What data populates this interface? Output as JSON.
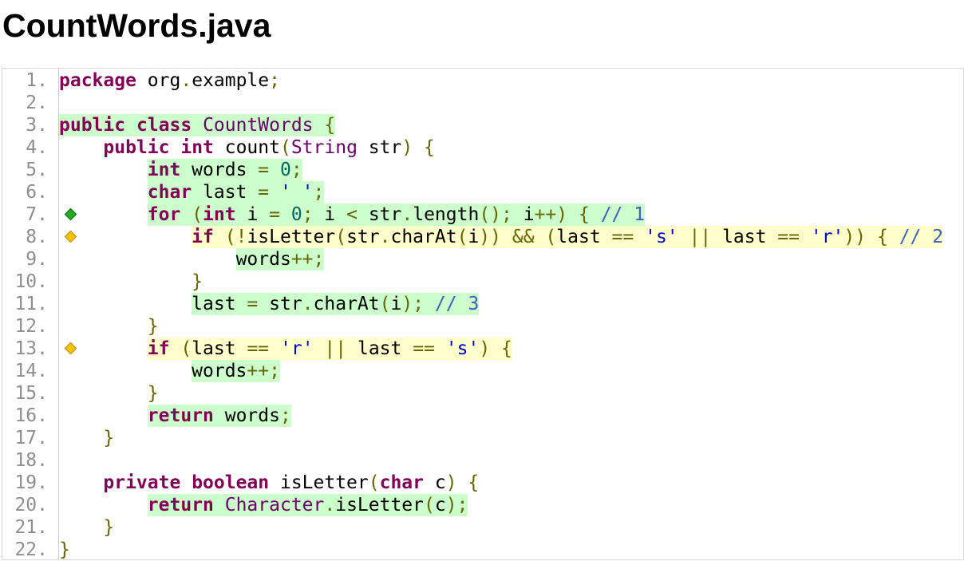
{
  "file": {
    "title": "CountWords.java"
  },
  "lines": [
    {
      "n": "1.",
      "cov": "none",
      "branch": "",
      "indent": "",
      "tokens": [
        {
          "t": "package",
          "c": "kw"
        },
        {
          "t": " org"
        },
        {
          "t": ".",
          "c": "pn"
        },
        {
          "t": "example"
        },
        {
          "t": ";",
          "c": "pn"
        }
      ]
    },
    {
      "n": "2.",
      "cov": "none",
      "branch": "",
      "indent": "",
      "tokens": []
    },
    {
      "n": "3.",
      "cov": "full",
      "branch": "",
      "indent": "",
      "tokens": [
        {
          "t": "public",
          "c": "kw"
        },
        {
          "t": " "
        },
        {
          "t": "class",
          "c": "kw"
        },
        {
          "t": " "
        },
        {
          "t": "CountWords",
          "c": "ty"
        },
        {
          "t": " "
        },
        {
          "t": "{",
          "c": "pn"
        }
      ]
    },
    {
      "n": "4.",
      "cov": "none",
      "branch": "",
      "indent": "    ",
      "tokens": [
        {
          "t": "public",
          "c": "kw"
        },
        {
          "t": " "
        },
        {
          "t": "int",
          "c": "kw"
        },
        {
          "t": " count"
        },
        {
          "t": "(",
          "c": "pn"
        },
        {
          "t": "String",
          "c": "ty"
        },
        {
          "t": " str"
        },
        {
          "t": ")",
          "c": "pn"
        },
        {
          "t": " "
        },
        {
          "t": "{",
          "c": "pn"
        }
      ]
    },
    {
      "n": "5.",
      "cov": "full",
      "branch": "",
      "indent": "        ",
      "tokens": [
        {
          "t": "int",
          "c": "kw"
        },
        {
          "t": " words "
        },
        {
          "t": "=",
          "c": "pn"
        },
        {
          "t": " "
        },
        {
          "t": "0",
          "c": "nm"
        },
        {
          "t": ";",
          "c": "pn"
        }
      ]
    },
    {
      "n": "6.",
      "cov": "full",
      "branch": "",
      "indent": "        ",
      "tokens": [
        {
          "t": "char",
          "c": "kw"
        },
        {
          "t": " last "
        },
        {
          "t": "=",
          "c": "pn"
        },
        {
          "t": " "
        },
        {
          "t": "' '",
          "c": "st"
        },
        {
          "t": ";",
          "c": "pn"
        }
      ]
    },
    {
      "n": "7.",
      "cov": "full",
      "branch": "green",
      "indent": "        ",
      "tokens": [
        {
          "t": "for",
          "c": "kw"
        },
        {
          "t": " "
        },
        {
          "t": "(",
          "c": "pn"
        },
        {
          "t": "int",
          "c": "kw"
        },
        {
          "t": " i "
        },
        {
          "t": "=",
          "c": "pn"
        },
        {
          "t": " "
        },
        {
          "t": "0",
          "c": "nm"
        },
        {
          "t": ";",
          "c": "pn"
        },
        {
          "t": " i "
        },
        {
          "t": "<",
          "c": "pn"
        },
        {
          "t": " str"
        },
        {
          "t": ".",
          "c": "pn"
        },
        {
          "t": "length"
        },
        {
          "t": "();",
          "c": "pn"
        },
        {
          "t": " i"
        },
        {
          "t": "++)",
          "c": "pn"
        },
        {
          "t": " "
        },
        {
          "t": "{",
          "c": "pn"
        },
        {
          "t": " "
        },
        {
          "t": "// 1",
          "c": "cm"
        }
      ]
    },
    {
      "n": "8.",
      "cov": "part",
      "branch": "yellow",
      "indent": "            ",
      "tokens": [
        {
          "t": "if",
          "c": "kw"
        },
        {
          "t": " "
        },
        {
          "t": "(!",
          "c": "pn"
        },
        {
          "t": "isLetter"
        },
        {
          "t": "(",
          "c": "pn"
        },
        {
          "t": "str"
        },
        {
          "t": ".",
          "c": "pn"
        },
        {
          "t": "charAt"
        },
        {
          "t": "(",
          "c": "pn"
        },
        {
          "t": "i"
        },
        {
          "t": "))",
          "c": "pn"
        },
        {
          "t": " "
        },
        {
          "t": "&&",
          "c": "pn"
        },
        {
          "t": " "
        },
        {
          "t": "(",
          "c": "pn"
        },
        {
          "t": "last "
        },
        {
          "t": "==",
          "c": "pn"
        },
        {
          "t": " "
        },
        {
          "t": "'s'",
          "c": "st"
        },
        {
          "t": " "
        },
        {
          "t": "||",
          "c": "pn"
        },
        {
          "t": " last "
        },
        {
          "t": "==",
          "c": "pn"
        },
        {
          "t": " "
        },
        {
          "t": "'r'",
          "c": "st"
        },
        {
          "t": "))",
          "c": "pn"
        },
        {
          "t": " "
        },
        {
          "t": "{",
          "c": "pn"
        },
        {
          "t": " "
        },
        {
          "t": "// 2",
          "c": "cm"
        }
      ]
    },
    {
      "n": "9.",
      "cov": "full",
      "branch": "",
      "indent": "                ",
      "tokens": [
        {
          "t": "words"
        },
        {
          "t": "++;",
          "c": "pn"
        }
      ]
    },
    {
      "n": "10.",
      "cov": "none",
      "branch": "",
      "indent": "            ",
      "tokens": [
        {
          "t": "}",
          "c": "pn"
        }
      ]
    },
    {
      "n": "11.",
      "cov": "full",
      "branch": "",
      "indent": "            ",
      "tokens": [
        {
          "t": "last "
        },
        {
          "t": "=",
          "c": "pn"
        },
        {
          "t": " str"
        },
        {
          "t": ".",
          "c": "pn"
        },
        {
          "t": "charAt"
        },
        {
          "t": "(",
          "c": "pn"
        },
        {
          "t": "i"
        },
        {
          "t": ");",
          "c": "pn"
        },
        {
          "t": " "
        },
        {
          "t": "// 3",
          "c": "cm"
        }
      ]
    },
    {
      "n": "12.",
      "cov": "none",
      "branch": "",
      "indent": "        ",
      "tokens": [
        {
          "t": "}",
          "c": "pn"
        }
      ]
    },
    {
      "n": "13.",
      "cov": "part",
      "branch": "yellow",
      "indent": "        ",
      "tokens": [
        {
          "t": "if",
          "c": "kw"
        },
        {
          "t": " "
        },
        {
          "t": "(",
          "c": "pn"
        },
        {
          "t": "last "
        },
        {
          "t": "==",
          "c": "pn"
        },
        {
          "t": " "
        },
        {
          "t": "'r'",
          "c": "st"
        },
        {
          "t": " "
        },
        {
          "t": "||",
          "c": "pn"
        },
        {
          "t": " last "
        },
        {
          "t": "==",
          "c": "pn"
        },
        {
          "t": " "
        },
        {
          "t": "'s'",
          "c": "st"
        },
        {
          "t": ")",
          "c": "pn"
        },
        {
          "t": " "
        },
        {
          "t": "{",
          "c": "pn"
        }
      ]
    },
    {
      "n": "14.",
      "cov": "full",
      "branch": "",
      "indent": "            ",
      "tokens": [
        {
          "t": "words"
        },
        {
          "t": "++;",
          "c": "pn"
        }
      ]
    },
    {
      "n": "15.",
      "cov": "none",
      "branch": "",
      "indent": "        ",
      "tokens": [
        {
          "t": "}",
          "c": "pn"
        }
      ]
    },
    {
      "n": "16.",
      "cov": "full",
      "branch": "",
      "indent": "        ",
      "tokens": [
        {
          "t": "return",
          "c": "kw"
        },
        {
          "t": " words"
        },
        {
          "t": ";",
          "c": "pn"
        }
      ]
    },
    {
      "n": "17.",
      "cov": "none",
      "branch": "",
      "indent": "    ",
      "tokens": [
        {
          "t": "}",
          "c": "pn"
        }
      ]
    },
    {
      "n": "18.",
      "cov": "none",
      "branch": "",
      "indent": "",
      "tokens": []
    },
    {
      "n": "19.",
      "cov": "none",
      "branch": "",
      "indent": "    ",
      "tokens": [
        {
          "t": "private",
          "c": "kw"
        },
        {
          "t": " "
        },
        {
          "t": "boolean",
          "c": "kw"
        },
        {
          "t": " isLetter"
        },
        {
          "t": "(",
          "c": "pn"
        },
        {
          "t": "char",
          "c": "kw"
        },
        {
          "t": " c"
        },
        {
          "t": ")",
          "c": "pn"
        },
        {
          "t": " "
        },
        {
          "t": "{",
          "c": "pn"
        }
      ]
    },
    {
      "n": "20.",
      "cov": "full",
      "branch": "",
      "indent": "        ",
      "tokens": [
        {
          "t": "return",
          "c": "kw"
        },
        {
          "t": " "
        },
        {
          "t": "Character",
          "c": "ty"
        },
        {
          "t": ".",
          "c": "pn"
        },
        {
          "t": "isLetter"
        },
        {
          "t": "(",
          "c": "pn"
        },
        {
          "t": "c"
        },
        {
          "t": ");",
          "c": "pn"
        }
      ]
    },
    {
      "n": "21.",
      "cov": "none",
      "branch": "",
      "indent": "    ",
      "tokens": [
        {
          "t": "}",
          "c": "pn"
        }
      ]
    },
    {
      "n": "22.",
      "cov": "none",
      "branch": "",
      "indent": "",
      "tokens": [
        {
          "t": "}",
          "c": "pn"
        }
      ]
    }
  ]
}
